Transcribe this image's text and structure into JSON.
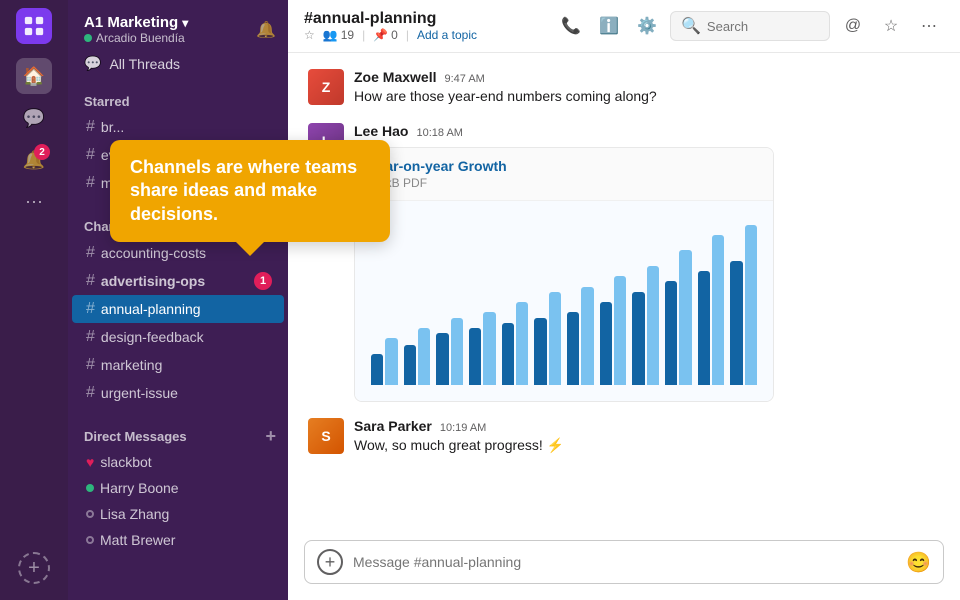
{
  "workspace": {
    "name": "A1 Marketing",
    "user": "Arcadio Buendía",
    "chevron": "›"
  },
  "sidebar": {
    "all_threads_label": "All Threads",
    "starred_label": "Starred",
    "starred_items": [
      {
        "label": "br..."
      },
      {
        "label": "ev..."
      },
      {
        "label": "m..."
      }
    ],
    "channels_label": "Channels",
    "channels": [
      {
        "label": "accounting-costs",
        "badge": null
      },
      {
        "label": "advertising-ops",
        "badge": 1
      },
      {
        "label": "annual-planning",
        "badge": null,
        "active": true
      },
      {
        "label": "design-feedback",
        "badge": null
      },
      {
        "label": "marketing",
        "badge": null
      },
      {
        "label": "urgent-issue",
        "badge": null
      }
    ],
    "dm_label": "Direct Messages",
    "dms": [
      {
        "label": "slackbot",
        "status": "heart"
      },
      {
        "label": "Harry Boone",
        "status": "online"
      },
      {
        "label": "Lisa Zhang",
        "status": "offline"
      },
      {
        "label": "Matt Brewer",
        "status": "offline"
      }
    ]
  },
  "channel": {
    "name": "#annual-planning",
    "members": "19",
    "pins": "0",
    "add_topic": "Add a topic",
    "search_placeholder": "Search"
  },
  "messages": [
    {
      "id": "zoe",
      "author": "Zoe Maxwell",
      "time": "9:47 AM",
      "text": "How are those year-end numbers coming along?",
      "initials": "Z"
    },
    {
      "id": "lee",
      "author": "Lee Hao",
      "time": "10:18 AM",
      "text": "",
      "initials": "L",
      "attachment": {
        "title": "Year-on-year Growth",
        "meta": "78 kB PDF"
      }
    },
    {
      "id": "sara",
      "author": "Sara Parker",
      "time": "10:19 AM",
      "text": "Wow, so much great progress! ⚡",
      "initials": "S"
    }
  ],
  "chart": {
    "bars": [
      {
        "dark": 30,
        "light": 45
      },
      {
        "dark": 38,
        "light": 55
      },
      {
        "dark": 50,
        "light": 65
      },
      {
        "dark": 55,
        "light": 70
      },
      {
        "dark": 60,
        "light": 80
      },
      {
        "dark": 65,
        "light": 90
      },
      {
        "dark": 70,
        "light": 95
      },
      {
        "dark": 80,
        "light": 105
      },
      {
        "dark": 90,
        "light": 115
      },
      {
        "dark": 100,
        "light": 130
      },
      {
        "dark": 110,
        "light": 145
      },
      {
        "dark": 120,
        "light": 155
      }
    ]
  },
  "tooltip": {
    "line1": "Channels are where teams share",
    "line2": "ideas and make decisions."
  },
  "input": {
    "placeholder": "Message #annual-planning"
  }
}
